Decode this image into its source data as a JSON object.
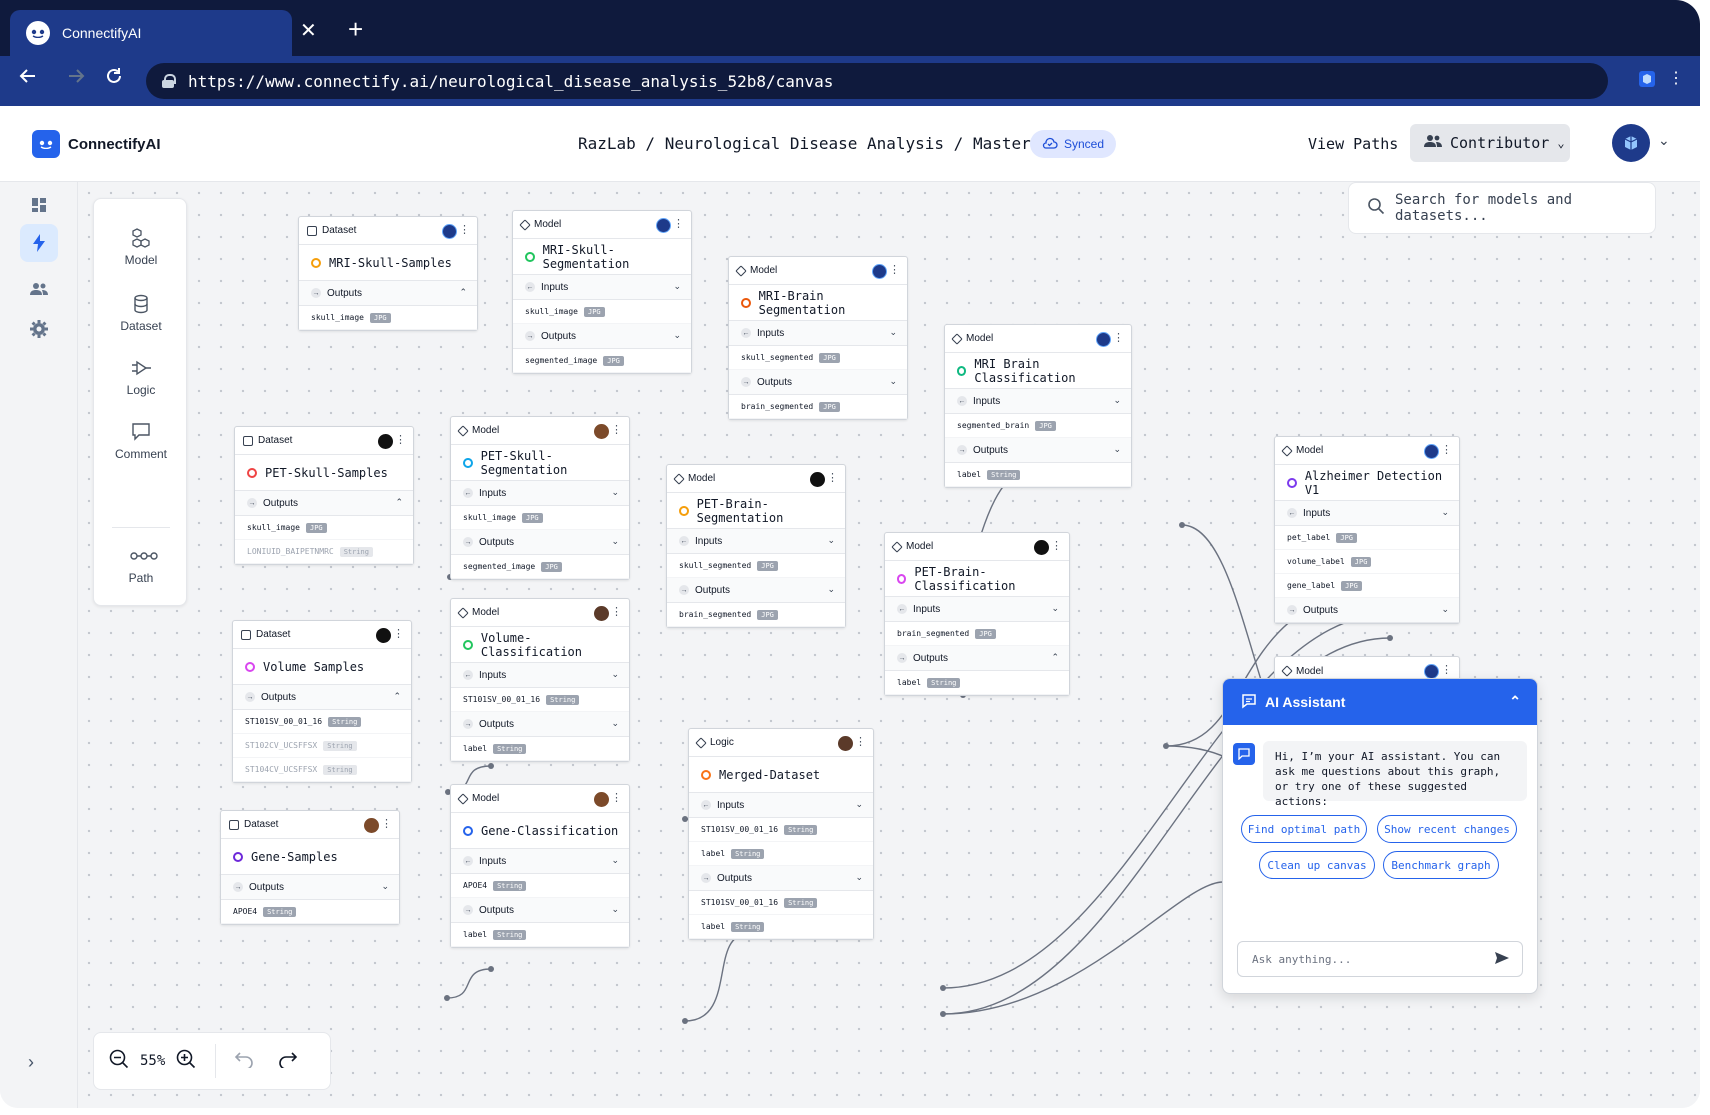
{
  "browser": {
    "tab_title": "ConnectifyAI",
    "url": "https://www.connectify.ai/neurological_disease_analysis_52b8/canvas"
  },
  "header": {
    "brand": "ConnectifyAI",
    "breadcrumb": "RazLab / Neurological Disease Analysis / Master",
    "sync_status": "Synced",
    "view_paths": "View Paths",
    "role": "Contributor"
  },
  "palette": {
    "items": [
      "Model",
      "Dataset",
      "Logic",
      "Comment",
      "Path"
    ]
  },
  "search": {
    "placeholder": "Search for models and datasets..."
  },
  "zoom": {
    "level": "55%"
  },
  "labels": {
    "inputs": "Inputs",
    "outputs": "Outputs"
  },
  "nodes": {
    "mri_skull_samples": {
      "kind": "Dataset",
      "title": "MRI-Skull-Samples",
      "dot": "#f59e0b",
      "outputs": [
        {
          "name": "skull_image",
          "type": "JPG"
        }
      ]
    },
    "mri_skull_seg": {
      "kind": "Model",
      "title": "MRI-Skull-Segmentation",
      "dot": "#22c55e",
      "inputs": [
        {
          "name": "skull_image",
          "type": "JPG"
        }
      ],
      "outputs": [
        {
          "name": "segmented_image",
          "type": "JPG"
        }
      ]
    },
    "mri_brain_seg": {
      "kind": "Model",
      "title": "MRI-Brain Segmentation",
      "dot": "#ea580c",
      "inputs": [
        {
          "name": "skull_segmented",
          "type": "JPG"
        }
      ],
      "outputs": [
        {
          "name": "brain_segmented",
          "type": "JPG"
        }
      ]
    },
    "mri_brain_class": {
      "kind": "Model",
      "title": "MRI Brain Classification",
      "dot": "#10b981",
      "inputs": [
        {
          "name": "segmented_brain",
          "type": "JPG"
        }
      ],
      "outputs": [
        {
          "name": "label",
          "type": "String"
        }
      ]
    },
    "pet_skull_samples": {
      "kind": "Dataset",
      "title": "PET-Skull-Samples",
      "dot": "#ef4444",
      "outputs": [
        {
          "name": "skull_image",
          "type": "JPG"
        },
        {
          "name": "LONIUID_BAIPETNMRC",
          "type": "String"
        }
      ]
    },
    "pet_skull_seg": {
      "kind": "Model",
      "title": "PET-Skull-Segmentation",
      "dot": "#0ea5e9",
      "inputs": [
        {
          "name": "skull_image",
          "type": "JPG"
        }
      ],
      "outputs": [
        {
          "name": "segmented_image",
          "type": "JPG"
        }
      ]
    },
    "pet_brain_seg": {
      "kind": "Model",
      "title": "PET-Brain-Segmentation",
      "dot": "#f59e0b",
      "inputs": [
        {
          "name": "skull_segmented",
          "type": "JPG"
        }
      ],
      "outputs": [
        {
          "name": "brain_segmented",
          "type": "JPG"
        }
      ]
    },
    "pet_brain_class": {
      "kind": "Model",
      "title": "PET-Brain-Classification",
      "dot": "#d946ef",
      "inputs": [
        {
          "name": "brain_segmented",
          "type": "JPG"
        }
      ],
      "outputs": [
        {
          "name": "label",
          "type": "String"
        }
      ]
    },
    "alz": {
      "kind": "Model",
      "title": "Alzheimer Detection V1",
      "dot": "#7c3aed",
      "inputs": [
        {
          "name": "pet_label",
          "type": "JPG"
        },
        {
          "name": "volume_label",
          "type": "JPG"
        },
        {
          "name": "gene_label",
          "type": "JPG"
        }
      ]
    },
    "hidden_model": {
      "kind": "Model"
    },
    "volume_samples": {
      "kind": "Dataset",
      "title": "Volume Samples",
      "dot": "#d946ef",
      "outputs": [
        {
          "name": "ST101SV_00_01_16",
          "type": "String"
        },
        {
          "name": "ST102CV_UCSFFSX",
          "type": "String"
        },
        {
          "name": "ST104CV_UCSFFSX",
          "type": "String"
        }
      ]
    },
    "volume_class": {
      "kind": "Model",
      "title": "Volume-Classification",
      "dot": "#22c55e",
      "inputs": [
        {
          "name": "ST101SV_00_01_16",
          "type": "String"
        }
      ],
      "outputs": [
        {
          "name": "label",
          "type": "String"
        }
      ]
    },
    "gene_samples": {
      "kind": "Dataset",
      "title": "Gene-Samples",
      "dot": "#6d28d9",
      "outputs": [
        {
          "name": "APOE4",
          "type": "String"
        }
      ]
    },
    "gene_class": {
      "kind": "Model",
      "title": "Gene-Classification",
      "dot": "#2563eb",
      "inputs": [
        {
          "name": "APOE4",
          "type": "String"
        }
      ],
      "outputs": [
        {
          "name": "label",
          "type": "String"
        }
      ]
    },
    "merged": {
      "kind": "Logic",
      "title": "Merged-Dataset",
      "dot": "#f97316",
      "inputs": [
        {
          "name": "ST101SV_00_01_16",
          "type": "String"
        },
        {
          "name": "label",
          "type": "String"
        }
      ],
      "outputs": [
        {
          "name": "ST101SV_00_01_16",
          "type": "String"
        },
        {
          "name": "label",
          "type": "String"
        }
      ]
    }
  },
  "ai": {
    "title": "AI Assistant",
    "message": "Hi, I’m your AI assistant. You can ask me questions about this graph, or try one of these suggested actions:",
    "chips": [
      "Find optimal path",
      "Show recent changes",
      "Clean up canvas",
      "Benchmark graph"
    ],
    "placeholder": "Ask anything..."
  }
}
